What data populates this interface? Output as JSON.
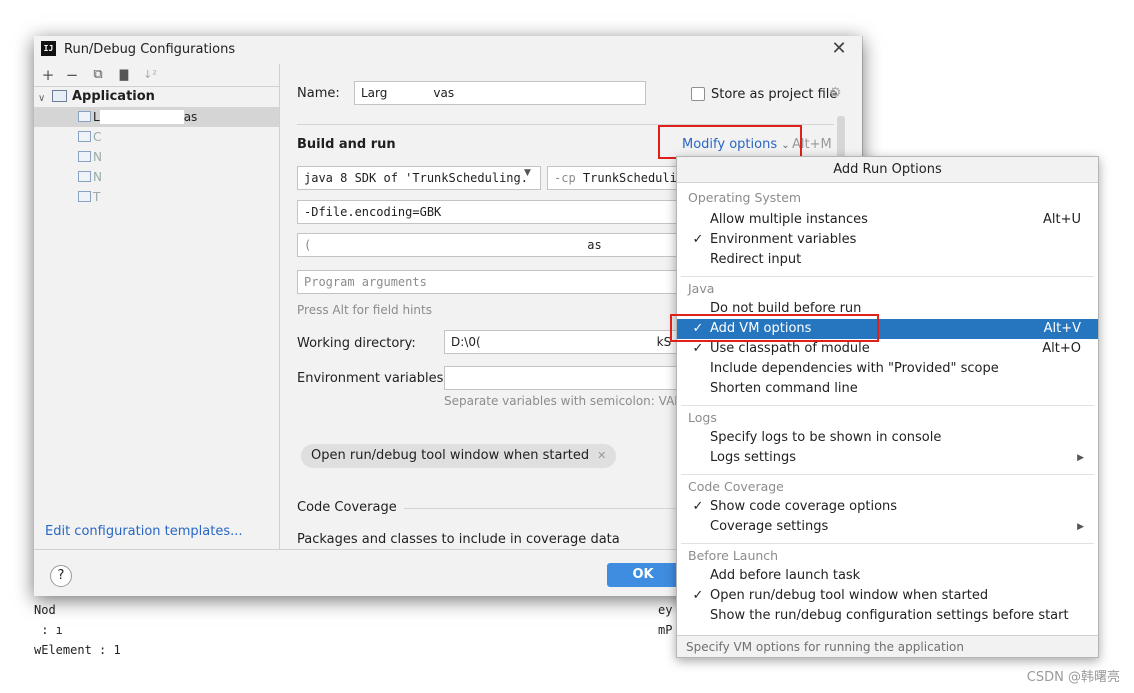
{
  "dialog": {
    "title": "Run/Debug Configurations",
    "app_icon_text": "IJ",
    "close_label": "✕"
  },
  "toolbar": {
    "add": "+",
    "remove": "−",
    "copy": "⧉",
    "folder": "▇",
    "sort": "↓²"
  },
  "tree": {
    "root_label": "Application",
    "selected_child_prefix": "L",
    "selected_child_suffix": "as",
    "children_prefixes": [
      "C",
      "N",
      "N",
      "T"
    ]
  },
  "left_footer": {
    "edit_templates": "Edit configuration templates..."
  },
  "form": {
    "name_label": "Name:",
    "name_prefix": "Larg",
    "name_suffix": "vas",
    "store_label": "Store as project file",
    "build_run_title": "Build and run",
    "modify_options": "Modify options",
    "modify_shortcut": "Alt+M",
    "jdk_select": "java 8 SDK of 'TrunkScheduling.",
    "cp_prefix": "-cp",
    "cp_value": "TrunkSchedulin",
    "vm_options": "-Dfile.encoding=GBK",
    "main_class_prefix": "(",
    "main_class_suffix": "as",
    "program_args_placeholder": "Program arguments",
    "field_hint": "Press Alt for field hints",
    "working_dir_label": "Working directory:",
    "working_dir_prefix": "D:\\0(",
    "working_dir_suffix": "kS",
    "env_vars_label": "Environment variables:",
    "env_hint": "Separate variables with semicolon: VAR",
    "chip_label": "Open run/debug tool window when started",
    "chip_close": "✕",
    "code_coverage": "Code Coverage",
    "packages_label": "Packages and classes to include in coverage data"
  },
  "bottom": {
    "help": "?",
    "ok": "OK"
  },
  "popup": {
    "header": "Add Run Options",
    "groups": [
      {
        "title": "Operating System",
        "items": [
          {
            "label": "Allow multiple instances",
            "checked": false,
            "shortcut": "Alt+U",
            "submenu": false
          },
          {
            "label": "Environment variables",
            "checked": true,
            "shortcut": "",
            "submenu": false
          },
          {
            "label": "Redirect input",
            "checked": false,
            "shortcut": "",
            "submenu": false
          }
        ]
      },
      {
        "title": "Java",
        "items": [
          {
            "label": "Do not build before run",
            "checked": false,
            "shortcut": "",
            "submenu": false
          },
          {
            "label": "Add VM options",
            "checked": true,
            "shortcut": "Alt+V",
            "submenu": false,
            "selected": true
          },
          {
            "label": "Use classpath of module",
            "checked": true,
            "shortcut": "Alt+O",
            "submenu": false
          },
          {
            "label": "Include dependencies with \"Provided\" scope",
            "checked": false,
            "shortcut": "",
            "submenu": false
          },
          {
            "label": "Shorten command line",
            "checked": false,
            "shortcut": "",
            "submenu": false
          }
        ]
      },
      {
        "title": "Logs",
        "items": [
          {
            "label": "Specify logs to be shown in console",
            "checked": false,
            "shortcut": "",
            "submenu": false
          },
          {
            "label": "Logs settings",
            "checked": false,
            "shortcut": "",
            "submenu": true
          }
        ]
      },
      {
        "title": "Code Coverage",
        "items": [
          {
            "label": "Show code coverage options",
            "checked": true,
            "shortcut": "",
            "submenu": false
          },
          {
            "label": "Coverage settings",
            "checked": false,
            "shortcut": "",
            "submenu": true
          }
        ]
      },
      {
        "title": "Before Launch",
        "items": [
          {
            "label": "Add before launch task",
            "checked": false,
            "shortcut": "",
            "submenu": false
          },
          {
            "label": "Open run/debug tool window when started",
            "checked": true,
            "shortcut": "",
            "submenu": false
          },
          {
            "label": "Show the run/debug configuration settings before start",
            "checked": false,
            "shortcut": "",
            "submenu": false
          }
        ]
      }
    ],
    "footer": "Specify VM options for running the application"
  },
  "console": {
    "lines": [
      "Nod",
      " : ı",
      "wElement : 1"
    ],
    "right_lines": [
      "ey",
      "mP"
    ]
  },
  "watermark": "CSDN @韩曙亮",
  "colors": {
    "accent": "#2867c4",
    "selection": "#2675bf",
    "highlight_box": "#e0201b",
    "ok_button": "#3f8de0"
  }
}
